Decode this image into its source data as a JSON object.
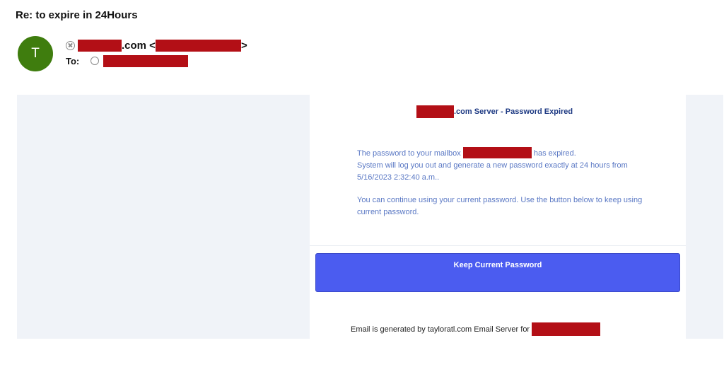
{
  "email": {
    "subject": "Re: to expire in 24Hours",
    "avatar_letter": "T",
    "from_domain_suffix": ".com <",
    "from_close": ">",
    "to_label": "To:"
  },
  "message": {
    "heading_suffix": ".com Server - Password Expired",
    "p1_before": "The password to your  mailbox ",
    "p1_after": " has expired.",
    "p1_line2": "System will log you out and generate a new password exactly at 24 hours from 5/16/2023 2:32:40 a.m..",
    "p2": "You can continue using your current password. Use the button below to keep using current password.",
    "button_label": "Keep Current Password",
    "footer_text": "Email is generated by tayloratl.com Email Server for"
  },
  "colors": {
    "avatar": "#3f7d0e",
    "redaction": "#b30f16",
    "button": "#4b5cf0",
    "heading": "#1f3b84",
    "body_text": "#5a78c4"
  }
}
